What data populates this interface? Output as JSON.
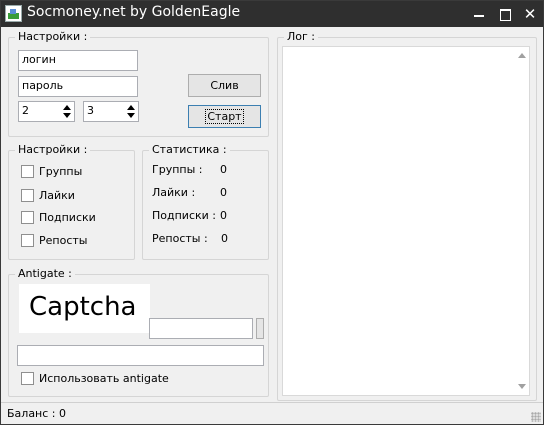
{
  "window": {
    "title": "Socmoney.net by GoldenEagle",
    "min_label": "",
    "close_label": "✕"
  },
  "settings_top": {
    "legend": "Настройки :",
    "login_value": "логин",
    "password_value": "пароль",
    "spin1_value": "2",
    "spin2_value": "3",
    "sliv_label": "Слив",
    "start_label": "Старт"
  },
  "settings_opts": {
    "legend": "Настройки :",
    "items": [
      {
        "label": "Группы",
        "checked": false
      },
      {
        "label": "Лайки",
        "checked": false
      },
      {
        "label": "Подписки",
        "checked": false
      },
      {
        "label": "Репосты",
        "checked": false
      }
    ]
  },
  "stats": {
    "legend": "Статистика :",
    "rows": [
      {
        "label": "Группы :",
        "value": "0"
      },
      {
        "label": "Лайки :",
        "value": "0"
      },
      {
        "label": "Подписки :",
        "value": "0"
      },
      {
        "label": "Репосты :",
        "value": "0"
      }
    ]
  },
  "antigate": {
    "legend": "Antigate :",
    "captcha_text": "Captcha",
    "captcha_input": "",
    "key_input": "",
    "use_label": "Использовать antigate",
    "use_checked": false
  },
  "log": {
    "legend": "Лог :",
    "content": ""
  },
  "status": {
    "balance": "Баланс : 0"
  }
}
